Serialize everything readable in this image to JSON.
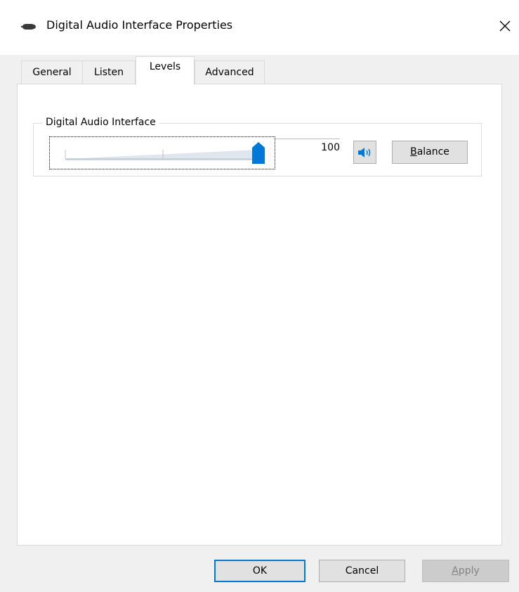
{
  "window": {
    "title": "Digital Audio Interface Properties",
    "title_icon": "speaker-device-icon",
    "close_icon": "close-icon"
  },
  "tabs": [
    {
      "label": "General",
      "active": false
    },
    {
      "label": "Listen",
      "active": false
    },
    {
      "label": "Levels",
      "active": true
    },
    {
      "label": "Advanced",
      "active": false
    }
  ],
  "levels": {
    "group_label": "Digital Audio Interface",
    "slider_value": 100,
    "value_text": "100",
    "mute_icon": "speaker-volume-icon",
    "balance_label_prefix": "",
    "balance_label_mnemonic": "B",
    "balance_label_rest": "alance"
  },
  "buttons": {
    "ok": "OK",
    "cancel": "Cancel",
    "apply_mnemonic": "A",
    "apply_rest": "pply"
  },
  "colors": {
    "accent": "#0078d7",
    "panel": "#ffffff",
    "chrome": "#f0f0f0"
  }
}
